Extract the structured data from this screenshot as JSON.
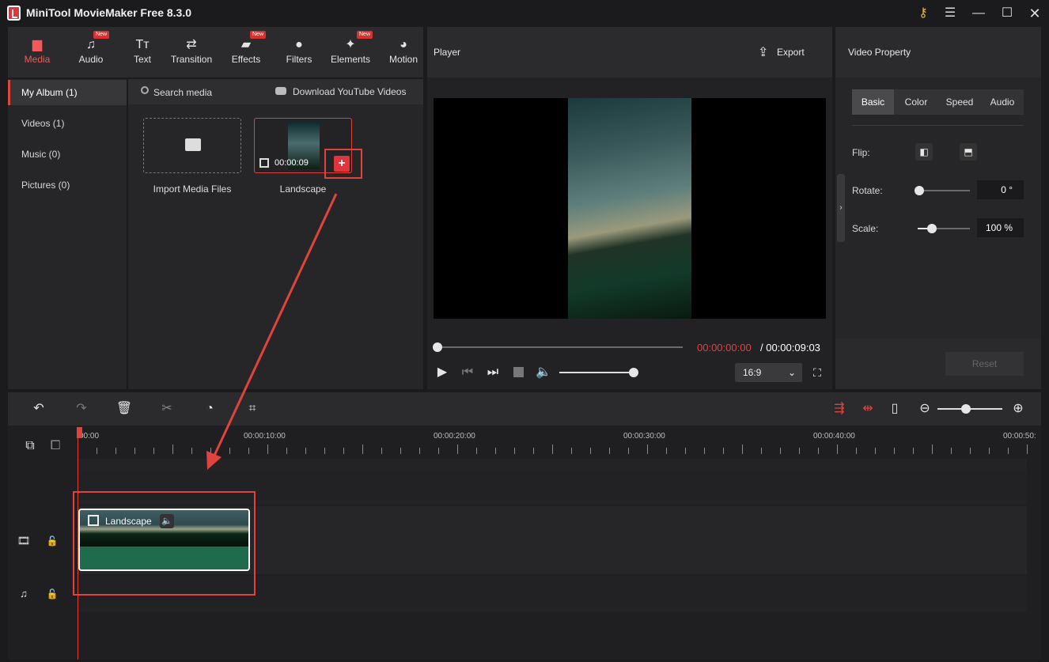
{
  "app": {
    "title": "MiniTool MovieMaker Free 8.3.0"
  },
  "toolbar": {
    "items": [
      {
        "label": "Media",
        "icon": "folder-icon",
        "new": false
      },
      {
        "label": "Audio",
        "icon": "music-icon",
        "new": true
      },
      {
        "label": "Text",
        "icon": "text-icon",
        "new": false
      },
      {
        "label": "Transition",
        "icon": "transition-icon",
        "new": false
      },
      {
        "label": "Effects",
        "icon": "effects-icon",
        "new": true
      },
      {
        "label": "Filters",
        "icon": "filters-icon",
        "new": false
      },
      {
        "label": "Elements",
        "icon": "elements-icon",
        "new": true
      },
      {
        "label": "Motion",
        "icon": "motion-icon",
        "new": false
      }
    ],
    "new_badge": "New"
  },
  "album": {
    "items": [
      "My Album (1)",
      "Videos (1)",
      "Music (0)",
      "Pictures (0)"
    ]
  },
  "media": {
    "search_placeholder": "Search media",
    "download_label": "Download YouTube Videos",
    "import_label": "Import Media Files",
    "clip_name": "Landscape",
    "clip_duration": "00:00:09",
    "add_button": "+"
  },
  "player": {
    "title": "Player",
    "export_label": "Export",
    "current_time": "00:00:00:00",
    "total_time": "/ 00:00:09:03",
    "aspect": "16:9",
    "progress": 0,
    "volume": 0.9
  },
  "property": {
    "title": "Video Property",
    "tabs": [
      "Basic",
      "Color",
      "Speed",
      "Audio"
    ],
    "flip_label": "Flip:",
    "rotate_label": "Rotate:",
    "rotate_value": "0 °",
    "scale_label": "Scale:",
    "scale_value": "100 %",
    "reset_label": "Reset"
  },
  "timeline": {
    "ruler": [
      "00:00",
      "00:00:10:00",
      "00:00:20:00",
      "00:00:30:00",
      "00:00:40:00",
      "00:00:50:"
    ],
    "clip_name": "Landscape"
  },
  "colors": {
    "accent": "#e0433c",
    "clip_green": "#1f6b4d"
  }
}
